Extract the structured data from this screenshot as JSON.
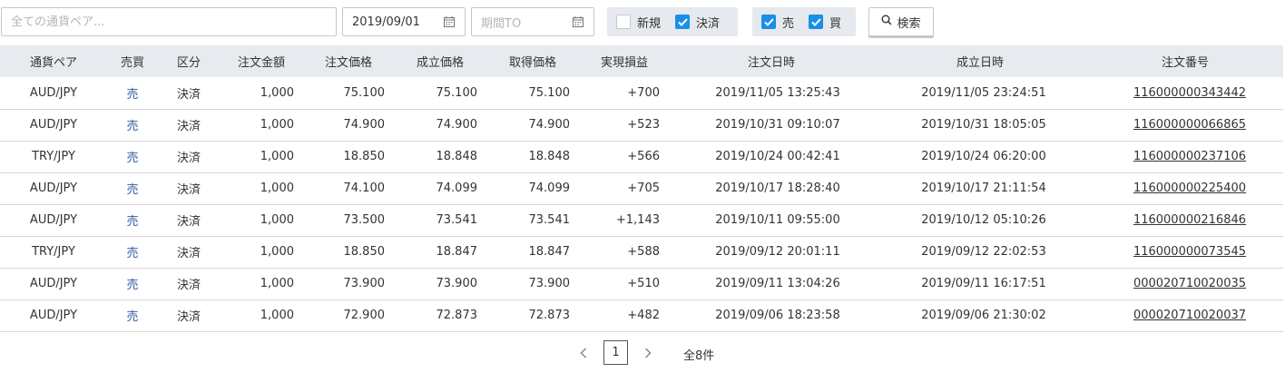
{
  "filters": {
    "pair_placeholder": "全ての通貨ペア...",
    "date_from": "2019/09/01",
    "date_to_placeholder": "期間TO",
    "type_options": [
      {
        "label": "新規",
        "checked": false
      },
      {
        "label": "決済",
        "checked": true
      }
    ],
    "side_options": [
      {
        "label": "売",
        "checked": true
      },
      {
        "label": "買",
        "checked": true
      }
    ],
    "search_label": "検索"
  },
  "table": {
    "headers": [
      "通貨ペア",
      "売買",
      "区分",
      "注文金額",
      "注文価格",
      "成立価格",
      "取得価格",
      "実現損益",
      "注文日時",
      "成立日時",
      "注文番号"
    ],
    "rows": [
      [
        "AUD/JPY",
        "売",
        "決済",
        "1,000",
        "75.100",
        "75.100",
        "75.100",
        "+700",
        "2019/11/05 13:25:43",
        "2019/11/05 23:24:51",
        "116000000343442"
      ],
      [
        "AUD/JPY",
        "売",
        "決済",
        "1,000",
        "74.900",
        "74.900",
        "74.900",
        "+523",
        "2019/10/31 09:10:07",
        "2019/10/31 18:05:05",
        "116000000066865"
      ],
      [
        "TRY/JPY",
        "売",
        "決済",
        "1,000",
        "18.850",
        "18.848",
        "18.848",
        "+566",
        "2019/10/24 00:42:41",
        "2019/10/24 06:20:00",
        "116000000237106"
      ],
      [
        "AUD/JPY",
        "売",
        "決済",
        "1,000",
        "74.100",
        "74.099",
        "74.099",
        "+705",
        "2019/10/17 18:28:40",
        "2019/10/17 21:11:54",
        "116000000225400"
      ],
      [
        "AUD/JPY",
        "売",
        "決済",
        "1,000",
        "73.500",
        "73.541",
        "73.541",
        "+1,143",
        "2019/10/11 09:55:00",
        "2019/10/12 05:10:26",
        "116000000216846"
      ],
      [
        "TRY/JPY",
        "売",
        "決済",
        "1,000",
        "18.850",
        "18.847",
        "18.847",
        "+588",
        "2019/09/12 20:01:11",
        "2019/09/12 22:02:53",
        "116000000073545"
      ],
      [
        "AUD/JPY",
        "売",
        "決済",
        "1,000",
        "73.900",
        "73.900",
        "73.900",
        "+510",
        "2019/09/11 13:04:26",
        "2019/09/11 16:17:51",
        "000020710020035"
      ],
      [
        "AUD/JPY",
        "売",
        "決済",
        "1,000",
        "72.900",
        "72.873",
        "72.873",
        "+482",
        "2019/09/06 18:23:58",
        "2019/09/06 21:30:02",
        "000020710020037"
      ]
    ]
  },
  "pagination": {
    "current_page": "1",
    "total": "全8件"
  },
  "colors": {
    "checkbox_on": "#1890e8",
    "header_bg": "#e7eaee",
    "sell_text": "#2c5aa0"
  }
}
